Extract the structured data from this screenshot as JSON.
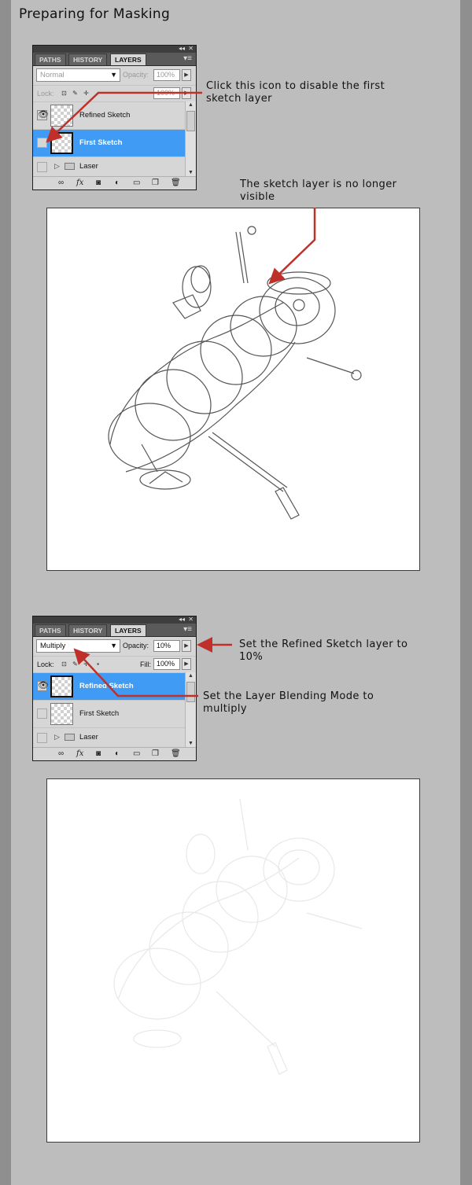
{
  "title": "Preparing for Masking",
  "panel1": {
    "tabs": [
      "PATHS",
      "HISTORY",
      "LAYERS"
    ],
    "blend_mode": "Normal",
    "opacity_label": "Opacity:",
    "opacity_value": "100%",
    "lock_label": "Lock:",
    "fill_value": "100%",
    "layers": [
      {
        "name": "Refined Sketch",
        "visible": true,
        "selected": false
      },
      {
        "name": "First Sketch",
        "visible": false,
        "selected": true
      },
      {
        "name": "Laser",
        "visible": false,
        "selected": false,
        "group": true
      }
    ]
  },
  "panel2": {
    "tabs": [
      "PATHS",
      "HISTORY",
      "LAYERS"
    ],
    "blend_mode": "Multiply",
    "opacity_label": "Opacity:",
    "opacity_value": "10%",
    "lock_label": "Lock:",
    "fill_label": "Fill:",
    "fill_value": "100%",
    "layers": [
      {
        "name": "Refined Sketch",
        "visible": true,
        "selected": true
      },
      {
        "name": "First Sketch",
        "visible": false,
        "selected": false
      },
      {
        "name": "Laser",
        "visible": false,
        "selected": false,
        "group": true
      }
    ]
  },
  "annotations": {
    "click_icon": "Click this icon to disable the first sketch layer",
    "no_longer_visible": "The sketch layer is no longer visible",
    "opacity_note": "Set the Refined Sketch layer to 10%",
    "blend_note": "Set the Layer Blending Mode to multiply"
  },
  "colors": {
    "accent_red": "#c0302a",
    "selected_layer": "#3f9bf3"
  },
  "icons": [
    "link-icon",
    "fx-icon",
    "mask-icon",
    "adjustment-icon",
    "folder-icon",
    "new-layer-icon",
    "trash-icon",
    "eye-icon",
    "panel-menu-icon"
  ]
}
